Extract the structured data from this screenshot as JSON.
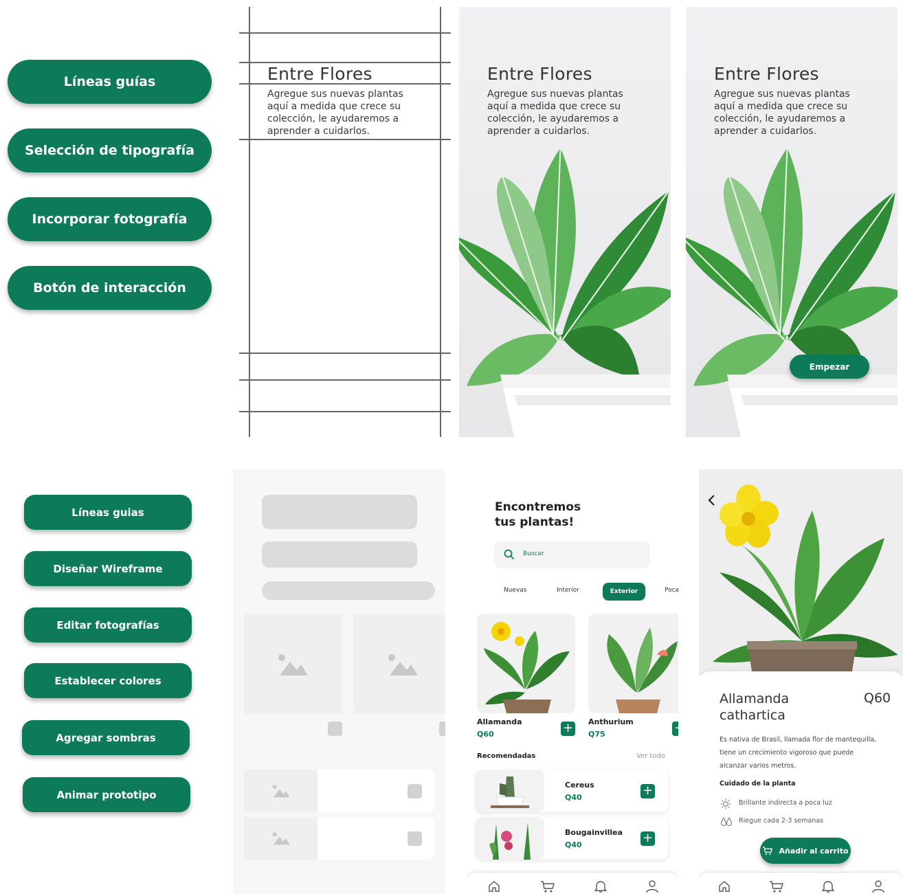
{
  "process_top": {
    "steps": [
      "Líneas guías",
      "Selección de tipografía",
      "Incorporar fotografía",
      "Botón de interacción"
    ]
  },
  "process_bottom": {
    "steps": [
      "Líneas guias",
      "Diseñar Wireframe",
      "Editar fotografías",
      "Establecer colores",
      "Agregar sombras",
      "Animar prototipo"
    ]
  },
  "onboarding": {
    "title": "Entre Flores",
    "description_lines": [
      "Agregue sus nuevas plantas",
      "aquí a medida que crece su",
      "colección, le ayudaremos a",
      "aprender a cuidarlos."
    ],
    "start_button": "Empezar"
  },
  "home": {
    "heading_lines": [
      "Encontremos",
      "tus plantas!"
    ],
    "search_placeholder": "Buscar",
    "tabs": [
      "Nuevas",
      "Interior",
      "Exterior",
      "Poca"
    ],
    "active_tab": "Exterior",
    "featured": [
      {
        "name": "Allamanda",
        "price": "Q60"
      },
      {
        "name": "Anthurium",
        "price": "Q75"
      }
    ],
    "recommended_label": "Recomendadas",
    "see_all": "Ver todo",
    "recommended": [
      {
        "name": "Cereus",
        "price": "Q40"
      },
      {
        "name": "Bougainvillea",
        "price": "Q40"
      }
    ]
  },
  "detail": {
    "name_lines": [
      "Allamanda",
      "cathartica"
    ],
    "price": "Q60",
    "description_lines": [
      "Es nativa de Brasil, llamada flor de mantequilla,",
      "tiene un crecimiento vigoroso que puede",
      "alcanzar varios metros."
    ],
    "care_title": "Cuidado de la planta",
    "care_items": [
      {
        "icon": "sun-icon",
        "text": "Brillante indirecta a poca luz"
      },
      {
        "icon": "water-drops-icon",
        "text": "Riegue cada 2-3 semanas"
      }
    ],
    "add_to_cart": "Añadir al carrito"
  },
  "icons": {
    "nav": [
      "home-icon",
      "cart-icon",
      "bell-icon",
      "user-icon"
    ],
    "back": "chevron-left-icon",
    "search": "search-icon",
    "image_placeholder": "image-placeholder-icon"
  },
  "colors": {
    "primary": "#0d7a5a",
    "placeholder_gray": "#dcdcdc",
    "placeholder_card": "#efefef",
    "photo_bg": "#eeeeef"
  }
}
